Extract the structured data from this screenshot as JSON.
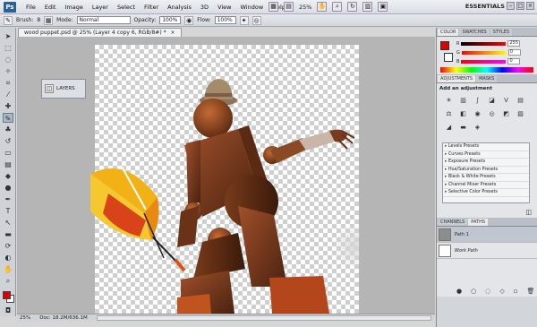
{
  "app": {
    "logo": "Ps",
    "menu": [
      "File",
      "Edit",
      "Image",
      "Layer",
      "Select",
      "Filter",
      "Analysis",
      "3D",
      "View",
      "Window",
      "Help"
    ],
    "zoom": "25%",
    "workspace_label": "ESSENTIALS"
  },
  "options": {
    "brush_label": "Brush:",
    "brush_size": "8",
    "mode_label": "Mode:",
    "mode_value": "Normal",
    "opacity_label": "Opacity:",
    "opacity_value": "100%",
    "flow_label": "Flow:",
    "flow_value": "100%"
  },
  "document": {
    "tab_title": "wood puppet.psd @ 25% (Layer 4 copy 6, RGB/8#) *",
    "tab_close": "×",
    "layers_button": "LAYERS"
  },
  "status": {
    "zoom": "25%",
    "doc_info": "Doc: 18.2M/636.1M"
  },
  "color_panel": {
    "tabs": [
      "COLOR",
      "SWATCHES",
      "STYLES"
    ],
    "r_value": "255",
    "g_value": "0",
    "b_value": "0"
  },
  "adjustments_panel": {
    "tabs": [
      "ADJUSTMENTS",
      "MASKS"
    ],
    "title": "Add an adjustment",
    "presets": [
      "Levels Presets",
      "Curves Presets",
      "Exposure Presets",
      "Hue/Saturation Presets",
      "Black & White Presets",
      "Channel Mixer Presets",
      "Selective Color Presets"
    ]
  },
  "paths_panel": {
    "tabs": [
      "CHANNELS",
      "PATHS"
    ],
    "items": [
      "Path 1",
      "Work Path"
    ]
  },
  "colors": {
    "foreground": "#e00000",
    "background": "#ffffff"
  }
}
